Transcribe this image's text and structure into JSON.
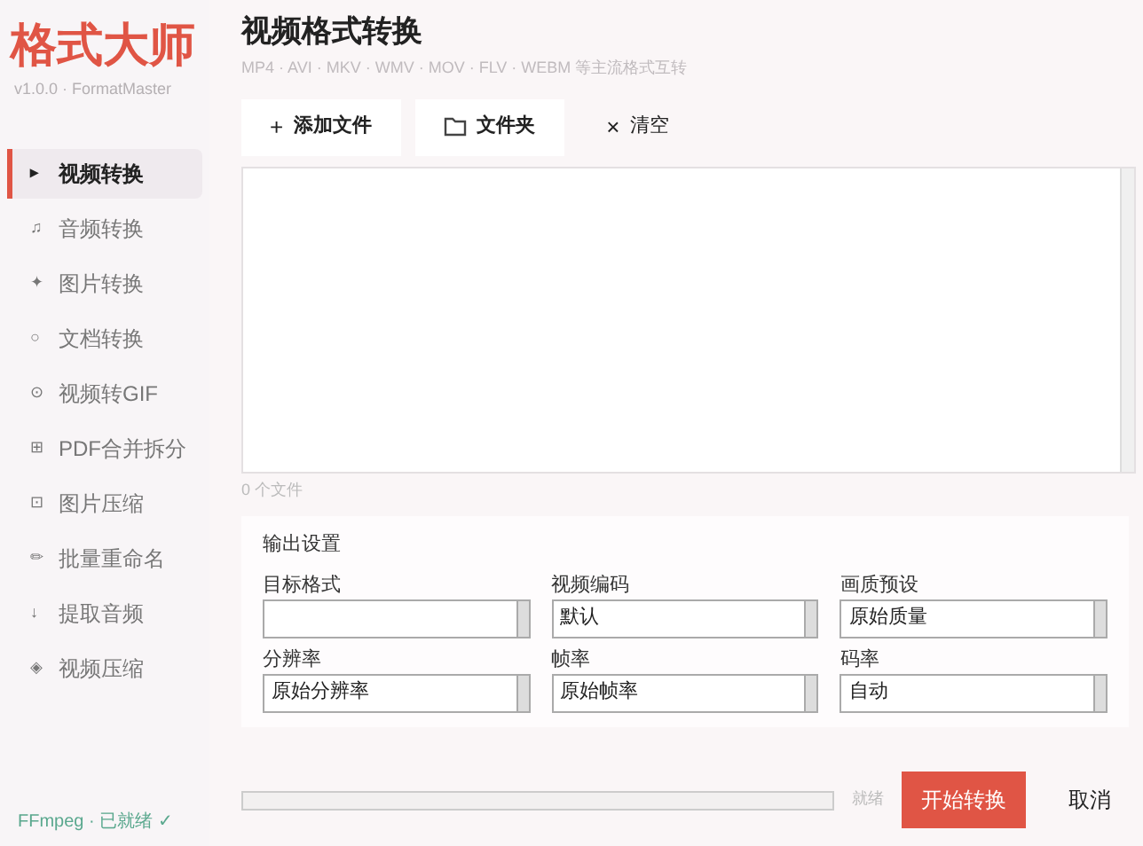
{
  "sidebar": {
    "logo": "格式大师",
    "version": "v1.0.0 · FormatMaster",
    "items": [
      {
        "icon": "▸",
        "label": "视频转换",
        "selected": true
      },
      {
        "icon": "♫",
        "label": "音频转换",
        "selected": false
      },
      {
        "icon": "✦",
        "label": "图片转换",
        "selected": false
      },
      {
        "icon": "○",
        "label": "文档转换",
        "selected": false
      },
      {
        "icon": "⊙",
        "label": "视频转GIF",
        "selected": false
      },
      {
        "icon": "⊞",
        "label": "PDF合并拆分",
        "selected": false
      },
      {
        "icon": "⊡",
        "label": "图片压缩",
        "selected": false
      },
      {
        "icon": "✏",
        "label": "批量重命名",
        "selected": false
      },
      {
        "icon": "↓",
        "label": "提取音频",
        "selected": false
      },
      {
        "icon": "◈",
        "label": "视频压缩",
        "selected": false
      }
    ],
    "status": "FFmpeg · 已就绪 ✓"
  },
  "header": {
    "title": "视频格式转换",
    "subtitle": "MP4 · AVI · MKV · WMV · MOV · FLV · WEBM 等主流格式互转"
  },
  "toolbar": [
    {
      "icon": "+",
      "label": "添加文件",
      "kind": "text"
    },
    {
      "label": "文件夹",
      "kind": "svg"
    },
    {
      "icon": "×",
      "label": "清空",
      "kind": "plain"
    }
  ],
  "file_count": "0 个文件",
  "output_settings": {
    "title": "输出设置",
    "fields": [
      {
        "label": "目标格式"
      },
      {
        "label": "视频编码",
        "value": "默认"
      },
      {
        "label": "画质预设",
        "value": "原始质量"
      },
      {
        "label": "分辨率",
        "value": "原始分辨率"
      },
      {
        "label": "帧率",
        "value": "原始帧率"
      },
      {
        "label": "码率",
        "value": "自动"
      }
    ]
  },
  "footer": {
    "progress": {
      "level": 0
    },
    "status": "就绪",
    "start_button": "开始转换",
    "cancel_button": "取消"
  }
}
